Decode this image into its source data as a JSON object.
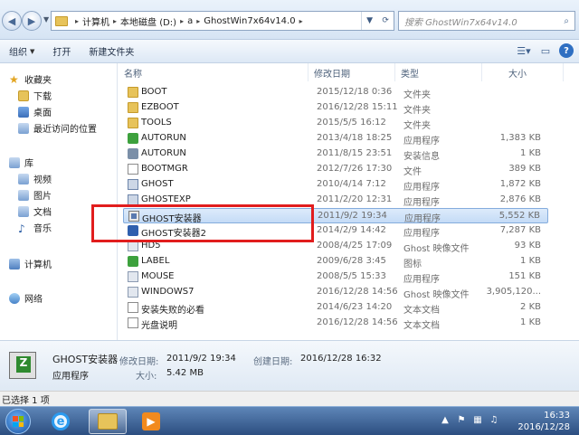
{
  "address": {
    "crumbs": [
      "计算机",
      "本地磁盘 (D:)",
      "a",
      "GhostWin7x64v14.0"
    ],
    "search_placeholder": "搜索 GhostWin7x64v14.0"
  },
  "toolbar": {
    "organize": "组织",
    "open": "打开",
    "new_folder": "新建文件夹"
  },
  "nav": {
    "favorites": "收藏夹",
    "downloads": "下载",
    "desktop": "桌面",
    "recent": "最近访问的位置",
    "libraries": "库",
    "videos": "视频",
    "pictures": "图片",
    "documents": "文档",
    "music": "音乐",
    "computer": "计算机",
    "network": "网络"
  },
  "columns": {
    "name": "名称",
    "date": "修改日期",
    "type": "类型",
    "size": "大小"
  },
  "files": [
    {
      "name": "BOOT",
      "date": "2015/12/18 0:36",
      "type": "文件夹",
      "size": "",
      "icon": "folder"
    },
    {
      "name": "EZBOOT",
      "date": "2016/12/28 15:11",
      "type": "文件夹",
      "size": "",
      "icon": "folder"
    },
    {
      "name": "TOOLS",
      "date": "2015/5/5 16:12",
      "type": "文件夹",
      "size": "",
      "icon": "folder"
    },
    {
      "name": "AUTORUN",
      "date": "2013/4/18 18:25",
      "type": "应用程序",
      "size": "1,383 KB",
      "icon": "green"
    },
    {
      "name": "AUTORUN",
      "date": "2011/8/15 23:51",
      "type": "安装信息",
      "size": "1 KB",
      "icon": "gear"
    },
    {
      "name": "BOOTMGR",
      "date": "2012/7/26 17:30",
      "type": "文件",
      "size": "389 KB",
      "icon": "file"
    },
    {
      "name": "GHOST",
      "date": "2010/4/14 7:12",
      "type": "应用程序",
      "size": "1,872 KB",
      "icon": "ghost3"
    },
    {
      "name": "GHOSTEXP",
      "date": "2011/2/20 12:31",
      "type": "应用程序",
      "size": "2,876 KB",
      "icon": "ghost3"
    },
    {
      "name": "GHOST安装器",
      "date": "2011/9/2 19:34",
      "type": "应用程序",
      "size": "5,552 KB",
      "icon": "ghost",
      "selected": true
    },
    {
      "name": "GHOST安装器2",
      "date": "2014/2/9 14:42",
      "type": "应用程序",
      "size": "7,287 KB",
      "icon": "ghost2"
    },
    {
      "name": "HD5",
      "date": "2008/4/25 17:09",
      "type": "Ghost 映像文件",
      "size": "93 KB",
      "icon": "app"
    },
    {
      "name": "LABEL",
      "date": "2009/6/28 3:45",
      "type": "图标",
      "size": "1 KB",
      "icon": "green"
    },
    {
      "name": "MOUSE",
      "date": "2008/5/5 15:33",
      "type": "应用程序",
      "size": "151 KB",
      "icon": "app"
    },
    {
      "name": "WINDOWS7",
      "date": "2016/12/28 14:56",
      "type": "Ghost 映像文件",
      "size": "3,905,120...",
      "icon": "app"
    },
    {
      "name": "安装失败的必看",
      "date": "2014/6/23 14:20",
      "type": "文本文档",
      "size": "2 KB",
      "icon": "txt"
    },
    {
      "name": "光盘说明",
      "date": "2016/12/28 14:56",
      "type": "文本文档",
      "size": "1 KB",
      "icon": "txt"
    }
  ],
  "details": {
    "name": "GHOST安装器",
    "type": "应用程序",
    "modified_label": "修改日期:",
    "modified_value": "2011/9/2 19:34",
    "created_label": "创建日期:",
    "created_value": "2016/12/28 16:32",
    "size_label": "大小:",
    "size_value": "5.42 MB"
  },
  "status": {
    "text": "已选择 1 项"
  },
  "taskbar": {
    "time": "16:33",
    "date": "2016/12/28"
  }
}
